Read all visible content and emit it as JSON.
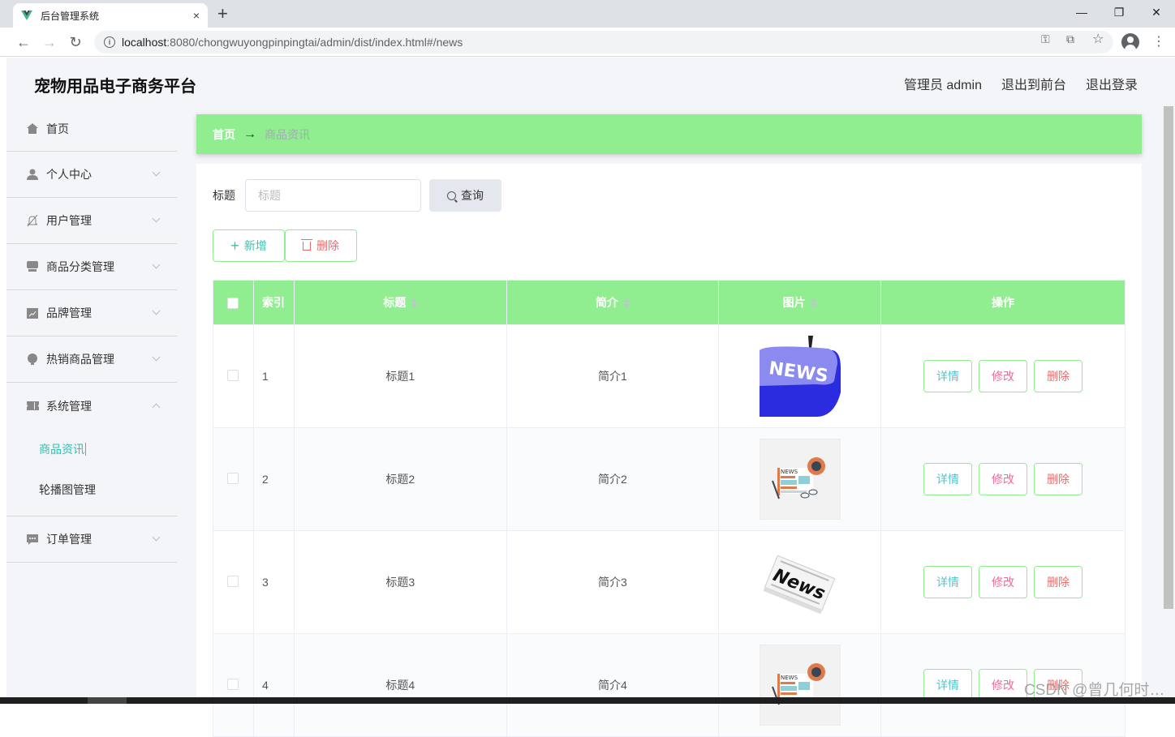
{
  "browser": {
    "tab_title": "后台管理系统",
    "tab_close": "×",
    "new_tab": "+",
    "url_host": "localhost",
    "url_rest": ":8080/chongwuyongpinpingtai/admin/dist/index.html#/news",
    "window_controls": {
      "minimize": "—",
      "restore": "❐",
      "close": "✕"
    }
  },
  "header": {
    "brand": "宠物用品电子商务平台",
    "admin_label": "管理员 admin",
    "to_front": "退出到前台",
    "logout": "退出登录"
  },
  "sidebar": {
    "items": [
      {
        "label": "首页",
        "icon": "home-icon",
        "has_chevron": false
      },
      {
        "label": "个人中心",
        "icon": "user-icon",
        "has_chevron": true
      },
      {
        "label": "用户管理",
        "icon": "bell-off-icon",
        "has_chevron": true
      },
      {
        "label": "商品分类管理",
        "icon": "shop-icon",
        "has_chevron": true
      },
      {
        "label": "品牌管理",
        "icon": "chart-icon",
        "has_chevron": true
      },
      {
        "label": "热销商品管理",
        "icon": "bulb-icon",
        "has_chevron": true
      },
      {
        "label": "系统管理",
        "icon": "ticket-icon",
        "has_chevron": true,
        "expanded": true,
        "children": [
          {
            "label": "商品资讯",
            "active": true
          },
          {
            "label": "轮播图管理",
            "active": false
          }
        ]
      },
      {
        "label": "订单管理",
        "icon": "message-icon",
        "has_chevron": true
      }
    ]
  },
  "breadcrumb": {
    "home": "首页",
    "separator": "→",
    "current": "商品资讯"
  },
  "search": {
    "label": "标题",
    "placeholder": "标题",
    "value": "",
    "button": "查询"
  },
  "actions": {
    "add": "新增",
    "delete": "删除"
  },
  "table": {
    "columns": [
      "索引",
      "标题",
      "简介",
      "图片",
      "操作"
    ],
    "rows": [
      {
        "index": "1",
        "title": "标题1",
        "intro": "简介1",
        "image": "news-keyboard-key"
      },
      {
        "index": "2",
        "title": "标题2",
        "intro": "简介2",
        "image": "news-flat-illustration"
      },
      {
        "index": "3",
        "title": "标题3",
        "intro": "简介3",
        "image": "news-newspaper"
      },
      {
        "index": "4",
        "title": "标题4",
        "intro": "简介4",
        "image": "news-flat-illustration"
      }
    ],
    "row_actions": {
      "detail": "详情",
      "edit": "修改",
      "remove": "删除"
    }
  },
  "colors": {
    "accent_green": "#90ee90",
    "active_teal": "#2ec0b0",
    "detail": "#4fc6d0",
    "edit": "#f06a9a",
    "remove": "#f06a6a"
  },
  "watermark": "CSDN @曾几何时…"
}
